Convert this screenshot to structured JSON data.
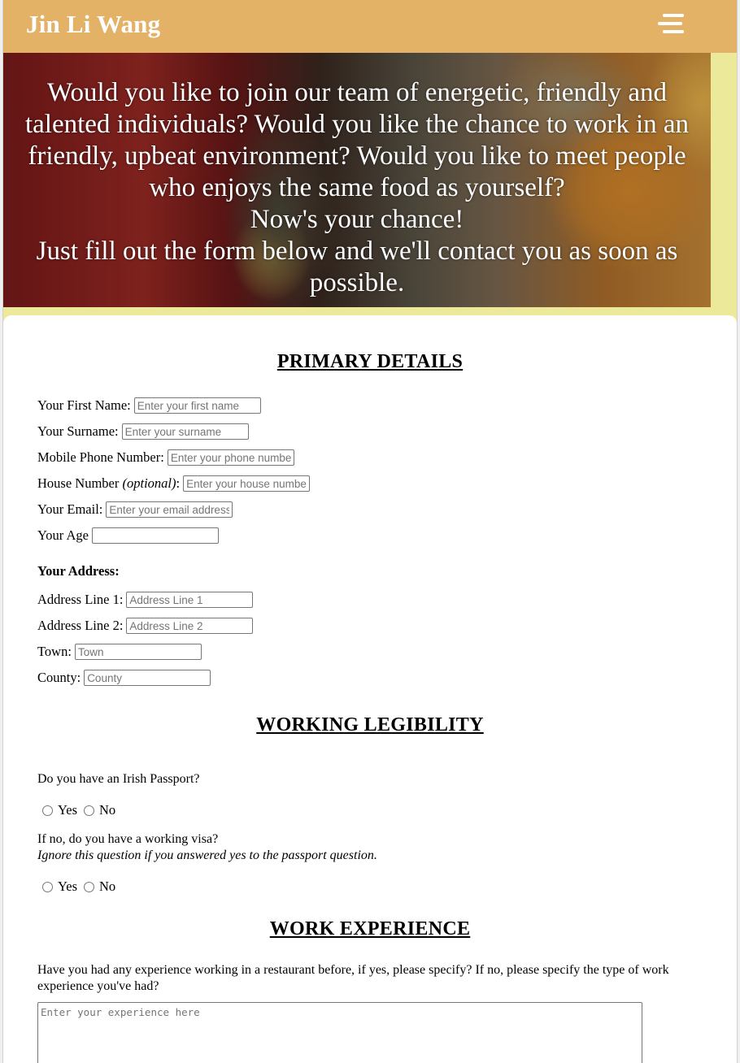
{
  "header": {
    "brand": "Jin Li Wang",
    "menu_icon": "hamburger-menu-icon"
  },
  "hero": {
    "lines": [
      "Would you like to join our team of energetic, friendly and",
      "talented individuals? Would you like the chance to work in an",
      "friendly, upbeat environment? Would you like to meet people",
      "who enjoys the same food as yourself?",
      "Now's your chance!",
      "Just fill out the form below and we'll contact you as soon as",
      "possible."
    ]
  },
  "primary": {
    "title": "PRIMARY DETAILS",
    "first_name": {
      "label": "Your First Name:",
      "placeholder": "Enter your first name"
    },
    "surname": {
      "label": "Your Surname:",
      "placeholder": "Enter your surname"
    },
    "phone": {
      "label": "Mobile Phone Number:",
      "placeholder": "Enter your phone number"
    },
    "house": {
      "label": "House Number ",
      "optional": "(optional)",
      "colon": ":",
      "placeholder": "Enter your house number"
    },
    "email": {
      "label": "Your Email:",
      "placeholder": "Enter your email address"
    },
    "age": {
      "label": "Your Age",
      "placeholder": ""
    },
    "address_heading": "Your Address:",
    "address1": {
      "label": "Address Line 1:",
      "placeholder": "Address Line 1"
    },
    "address2": {
      "label": "Address Line 2:",
      "placeholder": "Address Line 2"
    },
    "town": {
      "label": "Town:",
      "placeholder": "Town"
    },
    "county": {
      "label": "County:",
      "placeholder": "County"
    }
  },
  "legibility": {
    "title": "WORKING LEGIBILITY",
    "passport_question": "Do you have an Irish Passport?",
    "visa_question": "If no, do you have a working visa?",
    "visa_note": "Ignore this question if you answered yes to the passport question.",
    "yes": "Yes",
    "no": "No"
  },
  "experience": {
    "title": "WORK EXPERIENCE",
    "question": "Have you had any experience working in a restaurant before, if yes, please specify? If no, please specify the type of work experience you've had?",
    "placeholder": "Enter your experience here"
  }
}
